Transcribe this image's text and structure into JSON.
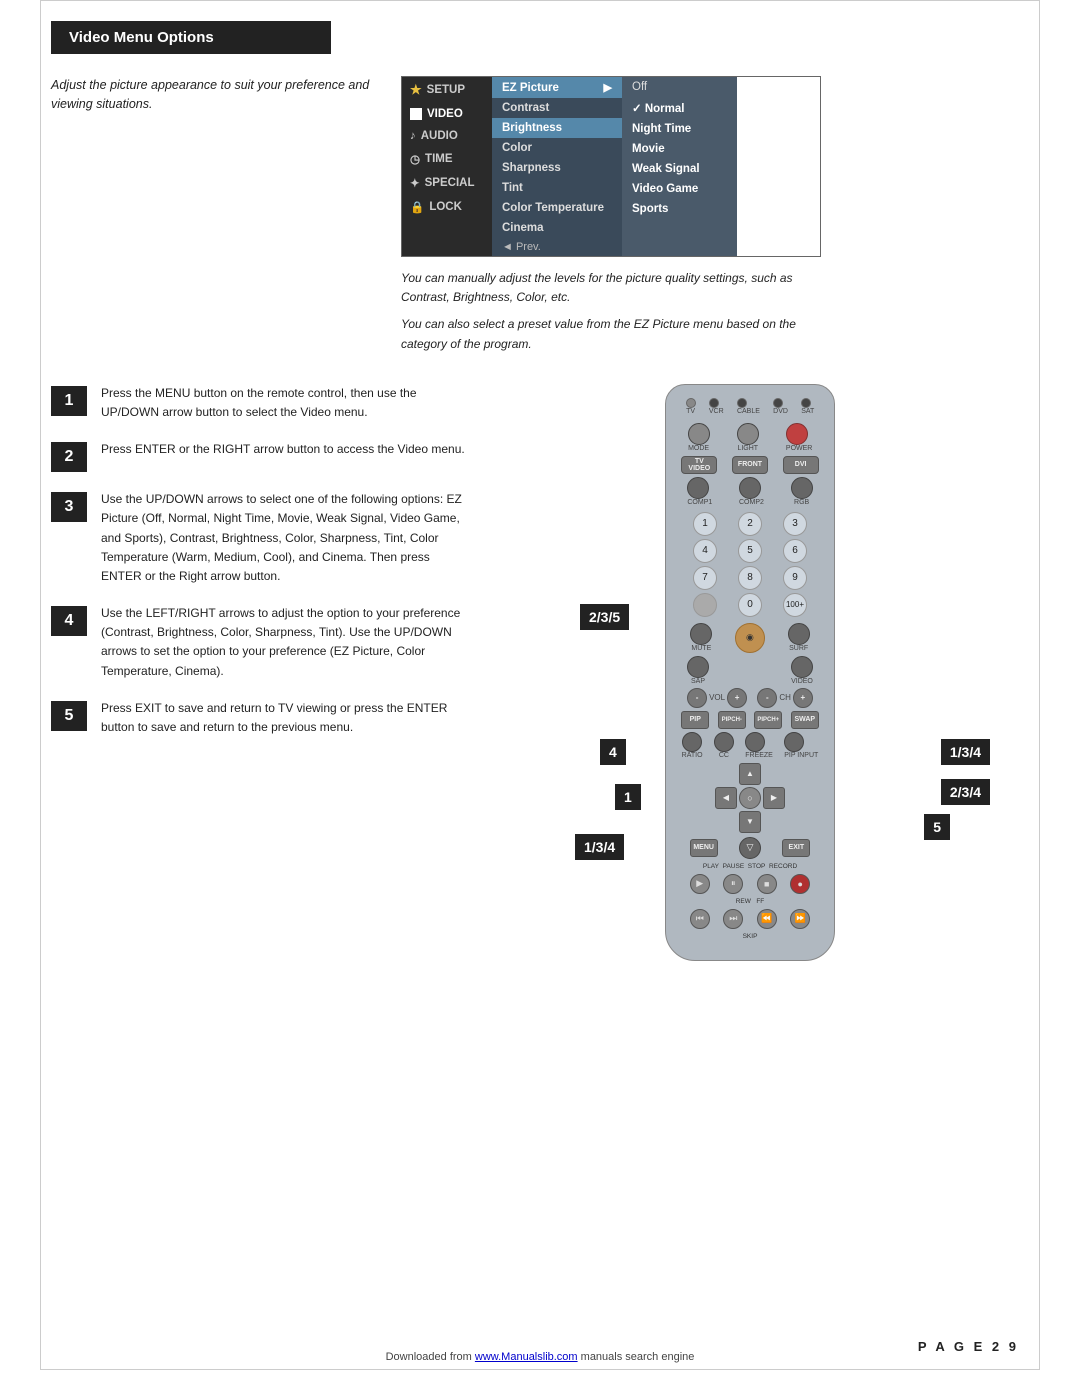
{
  "page": {
    "title": "Video Menu Options",
    "subtitle": "Adjust the picture appearance to suit your preference and viewing situations.",
    "caption1": "You can manually adjust the levels for the picture quality settings, such as Contrast, Brightness, Color, etc.",
    "caption2": "You can also select a preset value from the EZ Picture menu based on the category of the program.",
    "page_label": "P A G E   2 9"
  },
  "menu": {
    "left_items": [
      {
        "icon": "★",
        "label": "SETUP"
      },
      {
        "icon": "■",
        "label": "VIDEO",
        "active": true
      },
      {
        "icon": "♪",
        "label": "AUDIO"
      },
      {
        "icon": "◷",
        "label": "TIME"
      },
      {
        "icon": "✦",
        "label": "SPECIAL"
      },
      {
        "icon": "🔒",
        "label": "LOCK"
      }
    ],
    "mid_items": [
      {
        "label": "EZ Picture",
        "highlighted": true
      },
      {
        "label": "Contrast"
      },
      {
        "label": "Brightness"
      },
      {
        "label": "Color"
      },
      {
        "label": "Sharpness"
      },
      {
        "label": "Tint"
      },
      {
        "label": "Color Temperature"
      },
      {
        "label": "Cinema"
      }
    ],
    "right_items": [
      {
        "label": "Off"
      },
      {
        "label": "Normal",
        "checkmark": true,
        "bold": true
      },
      {
        "label": "Night Time",
        "bold": true
      },
      {
        "label": "Movie",
        "bold": true
      },
      {
        "label": "Weak Signal",
        "bold": true
      },
      {
        "label": "Video Game",
        "bold": true
      },
      {
        "label": "Sports",
        "bold": true
      }
    ],
    "prev_label": "◄ Prev."
  },
  "steps": [
    {
      "num": "1",
      "text": "Press the MENU button on the remote control, then use the UP/DOWN arrow button to select the Video menu."
    },
    {
      "num": "2",
      "text": "Press ENTER or the RIGHT arrow button to access the Video menu."
    },
    {
      "num": "3",
      "text": "Use the UP/DOWN arrows to select one of the following options: EZ Picture (Off, Normal, Night Time, Movie, Weak Signal, Video Game, and Sports), Contrast, Brightness, Color, Sharpness, Tint, Color Temperature (Warm, Medium, Cool), and Cinema. Then press ENTER or the Right arrow button."
    },
    {
      "num": "4",
      "text": "Use the LEFT/RIGHT arrows to adjust the option to your preference (Contrast, Brightness, Color, Sharpness, Tint). Use the UP/DOWN arrows to set the option to your preference (EZ Picture, Color Temperature, Cinema)."
    },
    {
      "num": "5",
      "text": "Press EXIT to save and return to TV viewing or press the ENTER button to save and return to the previous menu."
    }
  ],
  "badges": {
    "badge1": "2/3/5",
    "badge2": "1/3/4",
    "badge3": "2/3/4",
    "badge4": "5",
    "badge5": "4",
    "badge6": "1",
    "badge7": "1/3/4"
  },
  "footer": {
    "text": "Downloaded from ",
    "link_text": "www.Manualslib.com",
    "link_url": "#",
    "suffix": " manuals search engine"
  },
  "remote": {
    "top_labels": [
      "TV",
      "VCR",
      "CABLE",
      "DVD",
      "SAT"
    ],
    "mode_labels": [
      "MODE",
      "LIGHT",
      "POWER"
    ],
    "source_labels": [
      "TV/VIDEO",
      "FRONT",
      "DVI"
    ],
    "comp_labels": [
      "COMP1",
      "COMP2",
      "RGB"
    ],
    "numbers": [
      "1",
      "2",
      "3",
      "4",
      "5",
      "6",
      "7",
      "8",
      "9",
      "",
      "0",
      "100+"
    ],
    "mid_labels": [
      "MUTE",
      "",
      "SURF",
      "SAP",
      "VIDEO"
    ],
    "vol_ch": [
      "VOL",
      "CH"
    ],
    "pip_labels": [
      "PIP",
      "PIPCH-",
      "PIPCH+",
      "SWAP"
    ],
    "nav_labels": [
      "RATIO",
      "CC",
      "FREEZE",
      "PIP INPUT"
    ],
    "dpad_center": "⊙",
    "menu_exit": [
      "MENU",
      "▽",
      "EXIT"
    ],
    "transport_labels": [
      "PLAY",
      "PAUSE",
      "STOP",
      "RECORD"
    ],
    "rew_ff": [
      "REW",
      "FF",
      "",
      ""
    ],
    "skip": "SKIP"
  }
}
